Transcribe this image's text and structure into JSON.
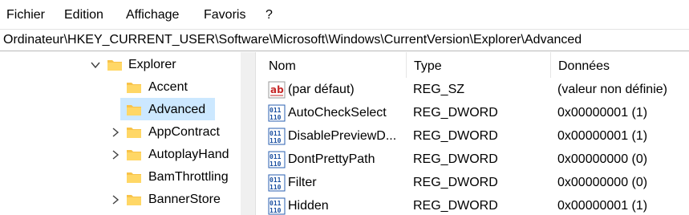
{
  "menu": {
    "fichier": "Fichier",
    "edition": "Edition",
    "affichage": "Affichage",
    "favoris": "Favoris",
    "help": "?"
  },
  "address": {
    "path": "Ordinateur\\HKEY_CURRENT_USER\\Software\\Microsoft\\Windows\\CurrentVersion\\Explorer\\Advanced"
  },
  "tree": {
    "items": [
      {
        "label": "Explorer",
        "expanded": true,
        "icon": "folder-icon"
      },
      {
        "label": "Accent",
        "icon": "folder-icon"
      },
      {
        "label": "Advanced",
        "selected": true,
        "icon": "folder-icon"
      },
      {
        "label": "AppContract",
        "icon": "folder-icon"
      },
      {
        "label": "AutoplayHand",
        "icon": "folder-icon"
      },
      {
        "label": "BamThrottling",
        "icon": "folder-icon"
      },
      {
        "label": "BannerStore",
        "icon": "folder-icon"
      }
    ]
  },
  "columns": {
    "name": "Nom",
    "type": "Type",
    "data": "Données"
  },
  "values": [
    {
      "name": "(par défaut)",
      "type": "REG_SZ",
      "data": "(valeur non définie)",
      "icon": "string-value-icon"
    },
    {
      "name": "AutoCheckSelect",
      "type": "REG_DWORD",
      "data": "0x00000001 (1)",
      "icon": "dword-value-icon"
    },
    {
      "name": "DisablePreviewD...",
      "type": "REG_DWORD",
      "data": "0x00000001 (1)",
      "icon": "dword-value-icon"
    },
    {
      "name": "DontPrettyPath",
      "type": "REG_DWORD",
      "data": "0x00000000 (0)",
      "icon": "dword-value-icon"
    },
    {
      "name": "Filter",
      "type": "REG_DWORD",
      "data": "0x00000000 (0)",
      "icon": "dword-value-icon"
    },
    {
      "name": "Hidden",
      "type": "REG_DWORD",
      "data": "0x00000001 (1)",
      "icon": "dword-value-icon"
    }
  ],
  "colors": {
    "selection": "#cce8ff",
    "folder": "#f8c34a"
  }
}
